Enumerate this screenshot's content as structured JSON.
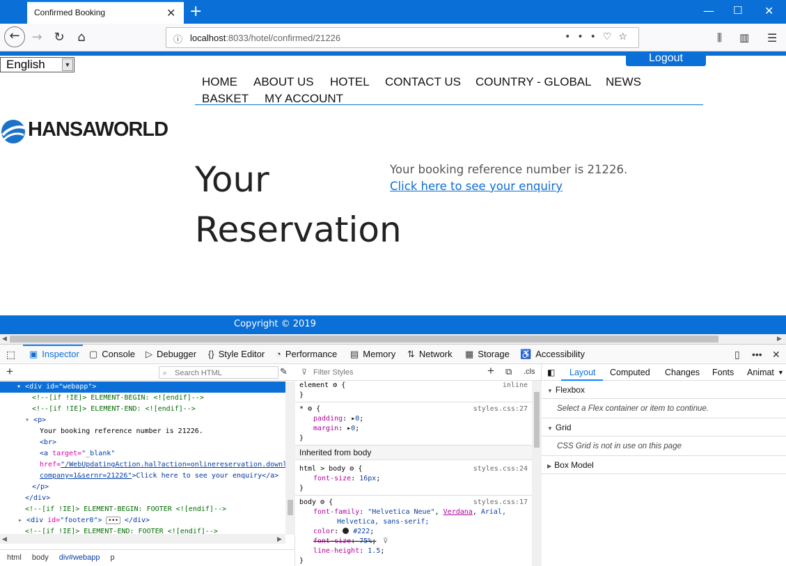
{
  "browser": {
    "tab_title": "Confirmed Booking",
    "url_host": "localhost",
    "url_path": ":8033/hotel/confirmed/21226"
  },
  "page": {
    "language": "English",
    "logout": "Logout",
    "menu": [
      "HOME",
      "ABOUT US",
      "HOTEL",
      "CONTACT US",
      "COUNTRY - GLOBAL",
      "NEWS",
      "BASKET",
      "MY ACCOUNT"
    ],
    "logo_text": "HANSAWORLD",
    "heading_line1": "Your",
    "heading_line2": "Reservation",
    "booking_text": "Your booking reference number is 21226.",
    "enquiry_link": "Click here to see your enquiry",
    "footer": "Copyright © 2019"
  },
  "devtools": {
    "tabs": [
      {
        "icon": "inspector-icon",
        "label": "Inspector"
      },
      {
        "icon": "console-icon",
        "label": "Console"
      },
      {
        "icon": "debugger-icon",
        "label": "Debugger"
      },
      {
        "icon": "style-editor-icon",
        "label": "Style Editor"
      },
      {
        "icon": "performance-icon",
        "label": "Performance"
      },
      {
        "icon": "memory-icon",
        "label": "Memory"
      },
      {
        "icon": "network-icon",
        "label": "Network"
      },
      {
        "icon": "storage-icon",
        "label": "Storage"
      },
      {
        "icon": "accessibility-icon",
        "label": "Accessibility"
      }
    ],
    "search_html_placeholder": "Search HTML",
    "filter_styles_placeholder": "Filter Styles",
    "cls_label": ".cls",
    "markup": {
      "l1": "<div id=\"webapp\">",
      "l2": "<!--[if !IE]> ELEMENT-BEGIN: <![endif]-->",
      "l3": "<!--[if !IE]> ELEMENT-END: <![endif]-->",
      "l4": "<p>",
      "l5": "Your booking reference number is 21226.",
      "l6": "<br>",
      "l7a": "<a ",
      "l7b": "target=",
      "l7c": "\"_blank\"",
      "l8a": "href=",
      "l8b": "\"/WebUpdatingAction.hal?action=onlinereservation.downl",
      "l9a": "company=1&sernr=21226\"",
      "l9b": ">Click here to see your enquiry</a>",
      "l10": "</p>",
      "l11": "</div>",
      "l12": "<!--[if !IE]> ELEMENT-BEGIN: FOOTER <![endif]-->",
      "l13a": "<div ",
      "l13b": "id=",
      "l13c": "\"footer0\"",
      "l13d": "> ",
      "l13e": " </div>",
      "l14": "<!--[if !IE]> ELEMENT-END: FOOTER <![endif]-->"
    },
    "breadcrumbs": [
      "html",
      "body",
      "div#webapp",
      "p"
    ],
    "rules": {
      "element_sel": "element",
      "element_src": "inline",
      "star_sel": "*",
      "star_src": "styles.css:27",
      "padding_prop": "padding",
      "padding_val": "0",
      "margin_prop": "margin",
      "margin_val": "0",
      "inherited": "Inherited from body",
      "htmlbody_sel": "html > body",
      "htmlbody_src": "styles.css:24",
      "fontsize_prop": "font-size",
      "fontsize_val": "16px",
      "body_sel": "body",
      "body_src": "styles.css:17",
      "fontfamily_prop": "font-family",
      "fontfamily_val1": "\"Helvetica Neue\"",
      "fontfamily_val2": "Verdana",
      "fontfamily_val3": "Arial,",
      "fontfamily_val4": "Helvetica, sans-serif;",
      "color_prop": "color",
      "color_val": "#222",
      "fontsize2_prop": "font-size",
      "fontsize2_val": "75%",
      "lineheight_prop": "line-height",
      "lineheight_val": "1.5"
    },
    "layout_tabs": [
      "Layout",
      "Computed",
      "Changes",
      "Fonts",
      "Animat"
    ],
    "layout": {
      "flexbox": "Flexbox",
      "flexbox_msg": "Select a Flex container or item to continue.",
      "grid": "Grid",
      "grid_msg": "CSS Grid is not in use on this page",
      "boxmodel": "Box Model"
    }
  },
  "colors": {
    "accent": "#0a6fd6",
    "text": "#222222"
  }
}
